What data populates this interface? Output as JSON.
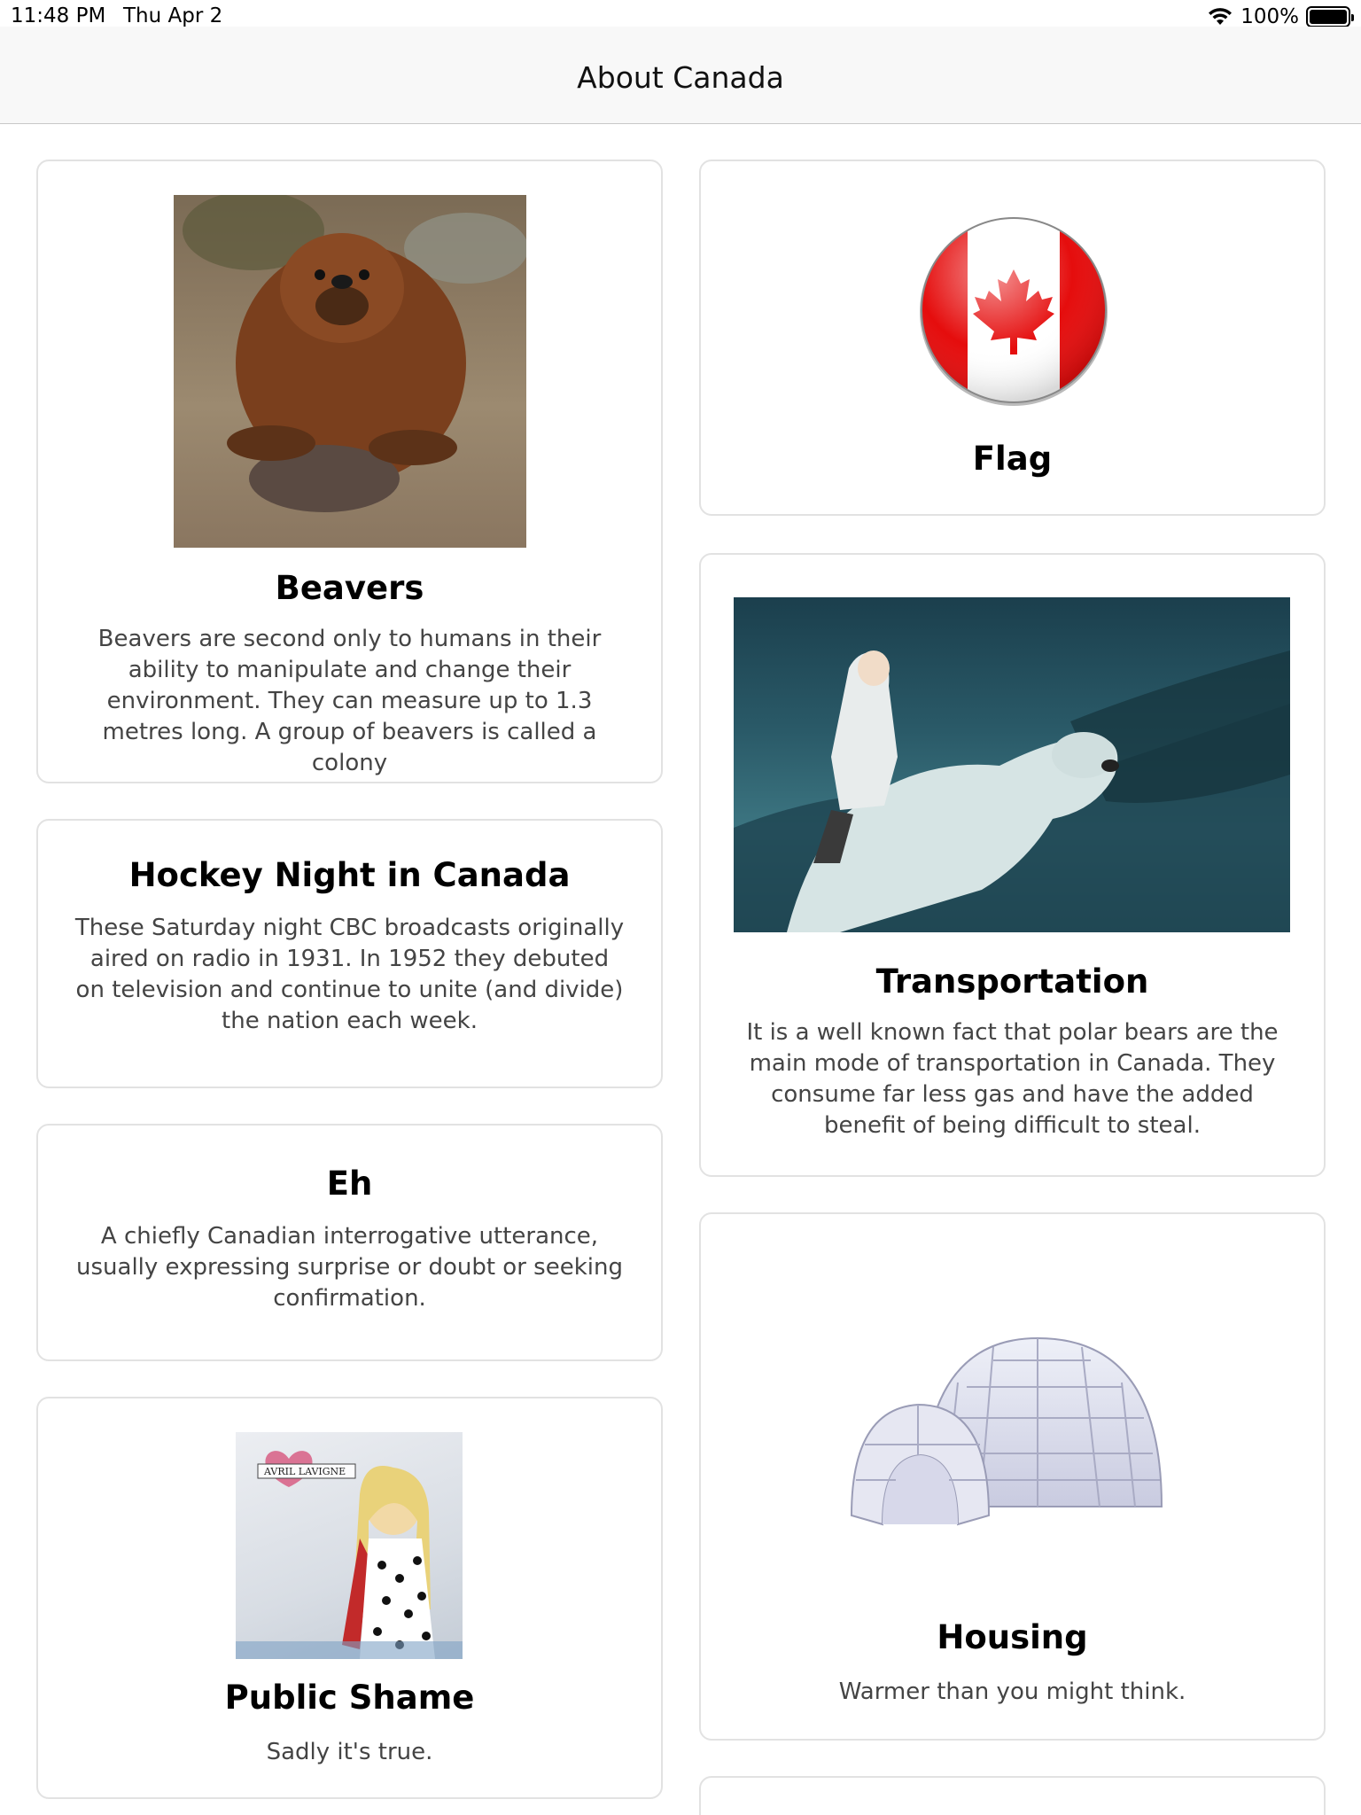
{
  "status_bar": {
    "time": "11:48 PM",
    "date": "Thu Apr 2",
    "battery": "100%"
  },
  "nav": {
    "title": "About Canada"
  },
  "cards": {
    "beavers": {
      "title": "Beavers",
      "description": "Beavers are second only to humans in their ability to manipulate and change their environment. They can measure up to 1.3 metres long. A group of beavers is called a colony"
    },
    "flag": {
      "title": "Flag"
    },
    "hockey": {
      "title": "Hockey Night in Canada",
      "description": "These Saturday night CBC broadcasts originally aired on radio in 1931. In 1952 they debuted on television and continue to unite (and divide) the nation each week."
    },
    "transportation": {
      "title": "Transportation",
      "description": "It is a well known fact that polar bears are the main mode of transportation in Canada. They consume far less gas and have the added benefit of being difficult to steal."
    },
    "eh": {
      "title": "Eh",
      "description": "A chiefly Canadian interrogative utterance, usually expressing surprise or doubt or seeking confirmation."
    },
    "housing": {
      "title": "Housing",
      "description": "Warmer than you might think."
    },
    "public_shame": {
      "title": "Public Shame",
      "description": "Sadly it's true.",
      "album_text": "AVRIL LAVIGNE"
    }
  },
  "colors": {
    "flag_red": "#e50d0d",
    "card_border": "#e2e2e2",
    "nav_bg": "#f8f8f8"
  }
}
